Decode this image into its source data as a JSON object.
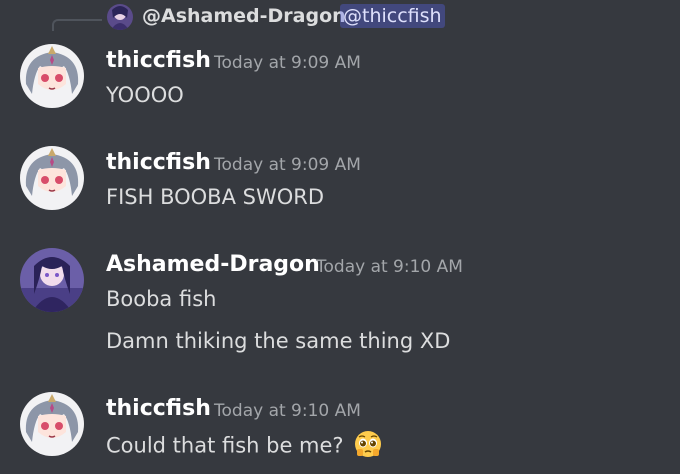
{
  "colors": {
    "background": "#36393f",
    "author": "#ffffff",
    "timestamp": "#a3a6aa",
    "message_text": "#dcddde",
    "mention_bg": "#5865f2",
    "mention_text": "#dee0fc"
  },
  "reply": {
    "author": "@Ashamed-Dragon",
    "mention": "@thiccfish"
  },
  "messages": [
    {
      "author": "thiccfish",
      "timestamp": "Today at 9:09 AM",
      "lines": [
        "YOOOO"
      ]
    },
    {
      "author": "thiccfish",
      "timestamp": "Today at 9:09 AM",
      "lines": [
        "FISH BOOBA SWORD"
      ]
    },
    {
      "author": "Ashamed-Dragon",
      "timestamp": "Today at 9:10 AM",
      "lines": [
        "Booba fish",
        "Damn thiking the same thing XD"
      ]
    },
    {
      "author": "thiccfish",
      "timestamp": "Today at 9:10 AM",
      "lines": [
        "Could that fish be me?"
      ],
      "emoji": "pleading-face-icon"
    }
  ]
}
